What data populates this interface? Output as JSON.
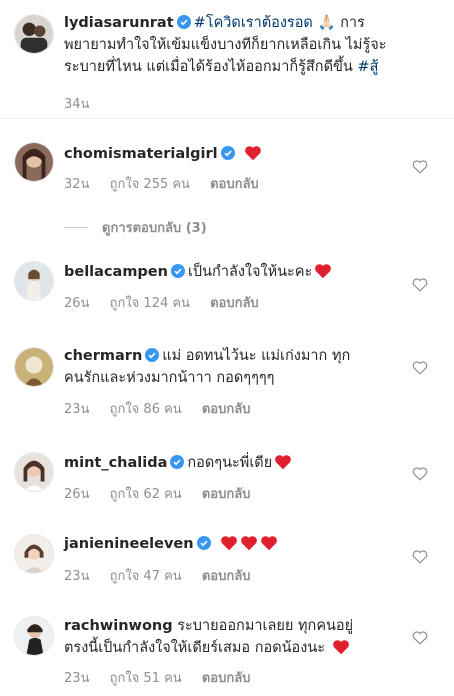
{
  "caption": {
    "username": "lydiasarunrat",
    "hashtag": "#โควิดเราต้องรอด",
    "emoji": "🙏🏻",
    "line1_tail": "การ",
    "line2": "พยายามทำใจให้เข้มแข็งบางทีก็ยากเหลือเกิน ไม่รู้จะ",
    "line3_text": "ระบายที่ไหน แต่เมื่อได้ร้องไห้ออกมาก็รู้สึกดีขึ้น",
    "line3_tag": "#สู้",
    "time": "34น"
  },
  "view_replies": "ดูการตอบกลับ (3)",
  "reply_label": "ตอบกลับ",
  "comments": [
    {
      "username": "chomismaterialgirl",
      "line1": "",
      "line2": "",
      "time": "32น",
      "likes": "ถูกใจ 255 คน",
      "hearts": 1
    },
    {
      "username": "bellacampen",
      "line1": "เป็นกำลังใจให้นะคะ",
      "line2": "",
      "time": "26น",
      "likes": "ถูกใจ 124 คน",
      "hearts": 1
    },
    {
      "username": "chermarn",
      "line1": "แม่ อดทนไว้นะ แม่เก่งมาก ทุก",
      "line2": "คนรักและห่วงมากน้าาา กอดๆๆๆๆ",
      "time": "23น",
      "likes": "ถูกใจ 86 คน",
      "hearts": 0
    },
    {
      "username": "mint_chalida",
      "line1": "กอดๆนะพี่เดีย",
      "line2": "",
      "time": "26น",
      "likes": "ถูกใจ 62 คน",
      "hearts": 1
    },
    {
      "username": "janienineeleven",
      "line1": "",
      "line2": "",
      "time": "23น",
      "likes": "ถูกใจ 47 คน",
      "hearts": 3
    },
    {
      "username": "rachwinwong",
      "line1": "ระบายออกมาเลยย ทุกคนอยู่",
      "line2": "ตรงนี้เป็นกำลังใจให้เดียร์เสมอ กอดน้องนะ",
      "time": "23น",
      "likes": "ถูกใจ 51 คน",
      "hearts": 1
    }
  ],
  "colors": {
    "text": "#262626",
    "muted": "#8e8e8e",
    "hashtag": "#00376b",
    "verified": "#3897f0",
    "heart_red": "#ed4956"
  }
}
